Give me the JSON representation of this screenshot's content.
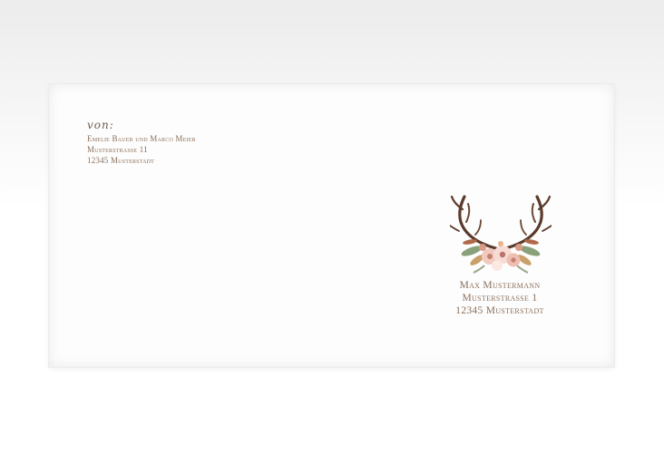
{
  "sender": {
    "from_label": "von:",
    "lines": [
      "Emelie Bauer und Marco Meier",
      "Musterstrasse 11",
      "12345 Musterstadt"
    ]
  },
  "recipient": {
    "lines": [
      "Max Mustermann",
      "Musterstrasse 1",
      "12345 Musterstadt"
    ]
  },
  "colors": {
    "text": "#8a6f5a",
    "antler": "#5a3a2a",
    "flower_pink": "#f2c9bf"
  },
  "decoration": "antler-floral-wreath"
}
